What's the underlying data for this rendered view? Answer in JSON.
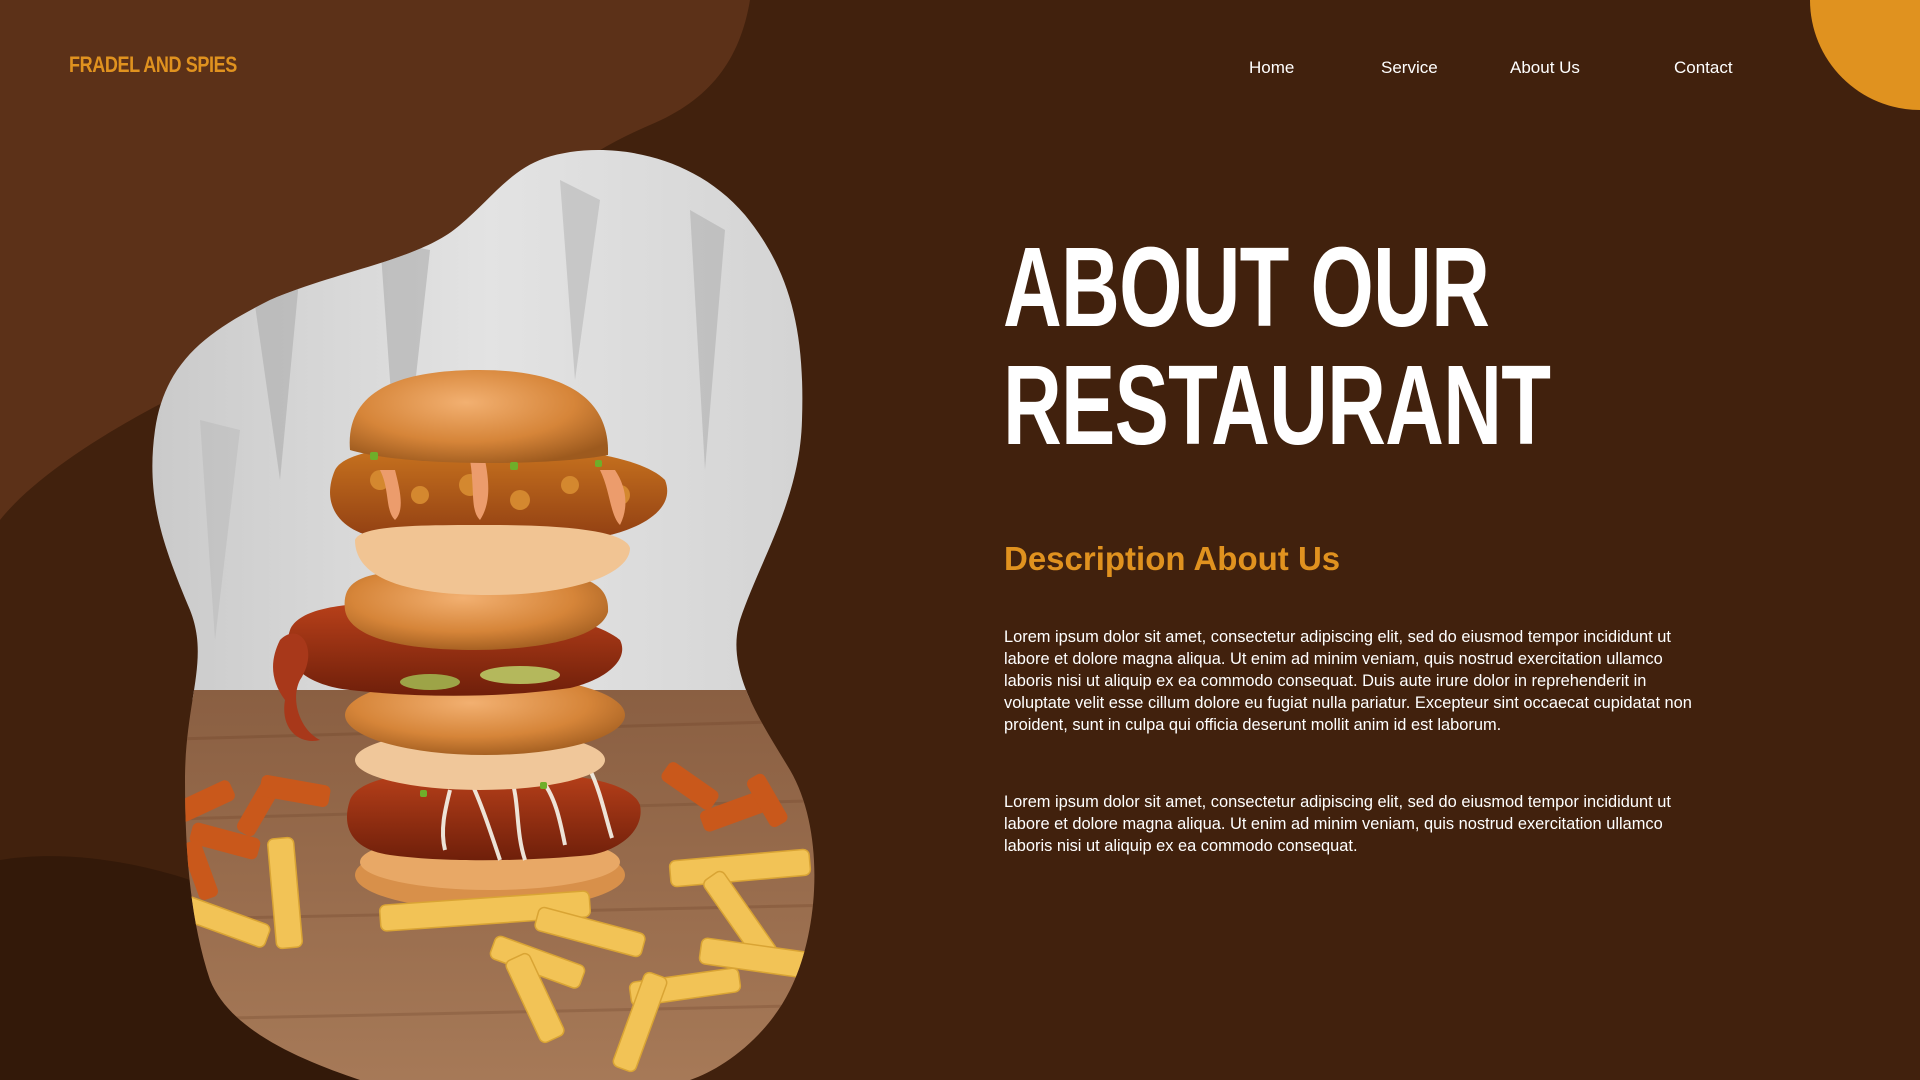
{
  "brand": {
    "logo_text": "FRADEL AND SPIES"
  },
  "nav": {
    "items": [
      {
        "label": "Home"
      },
      {
        "label": "Service"
      },
      {
        "label": "About Us"
      },
      {
        "label": "Contact"
      }
    ]
  },
  "hero": {
    "title_line1": "ABOUT OUR",
    "title_line2": "RESTAURANT",
    "subheading": "Description About Us",
    "paragraph1": "Lorem ipsum dolor sit amet, consectetur adipiscing elit, sed do eiusmod tempor incididunt ut labore et dolore magna aliqua. Ut enim ad minim veniam, quis nostrud exercitation ullamco laboris nisi ut aliquip ex ea commodo consequat. Duis aute irure dolor in reprehenderit in voluptate velit esse cillum dolore eu fugiat nulla pariatur. Excepteur sint occaecat cupidatat non proident, sunt in culpa qui officia deserunt mollit anim id est laborum.",
    "paragraph2": "Lorem ipsum dolor sit amet, consectetur adipiscing elit, sed do eiusmod tempor incididunt ut labore et dolore magna aliqua. Ut enim ad minim veniam, quis nostrud exercitation ullamco laboris nisi ut aliquip ex ea commodo consequat."
  },
  "image": {
    "subject": "burger-stack-with-fries-photo"
  },
  "colors": {
    "background": "#41210d",
    "blob_light": "#5c3118",
    "blob_dark": "#331909",
    "accent": "#e0921f",
    "text": "#ffffff"
  }
}
